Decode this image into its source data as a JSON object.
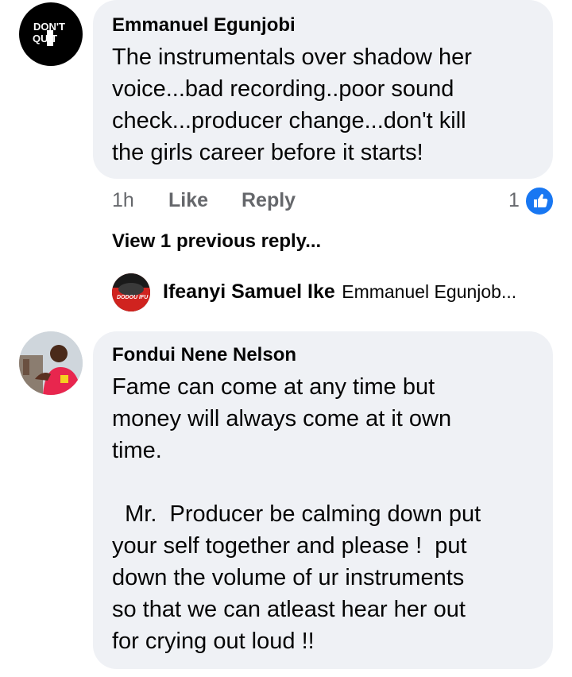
{
  "comment1": {
    "avatar_text_top": "DON'T",
    "avatar_text_bottom": "QUIT",
    "author": "Emmanuel Egunjobi",
    "text": "The instrumentals over shadow her\nvoice...bad recording..poor sound\ncheck...producer change...don't kill\nthe girls career before it starts!",
    "time": "1h",
    "like_label": "Like",
    "reply_label": "Reply",
    "reaction_count": "1"
  },
  "view_previous": "View 1 previous reply...",
  "reply_preview": {
    "avatar_text": "DODOU IFU",
    "author": "Ifeanyi Samuel Ike",
    "text": "Emmanuel Egunjob..."
  },
  "comment2": {
    "author": "Fondui Nene Nelson",
    "text": "Fame can come at any time but\nmoney will always come at it own\ntime.\n\n  Mr.  Producer be calming down put\nyour self together and please !  put\ndown the volume of ur instruments\nso that we can atleast hear her out\nfor crying out loud !!"
  },
  "colors": {
    "bubble": "#eff1f5",
    "meta_text": "#65676b",
    "like_blue": "#1877f2"
  }
}
